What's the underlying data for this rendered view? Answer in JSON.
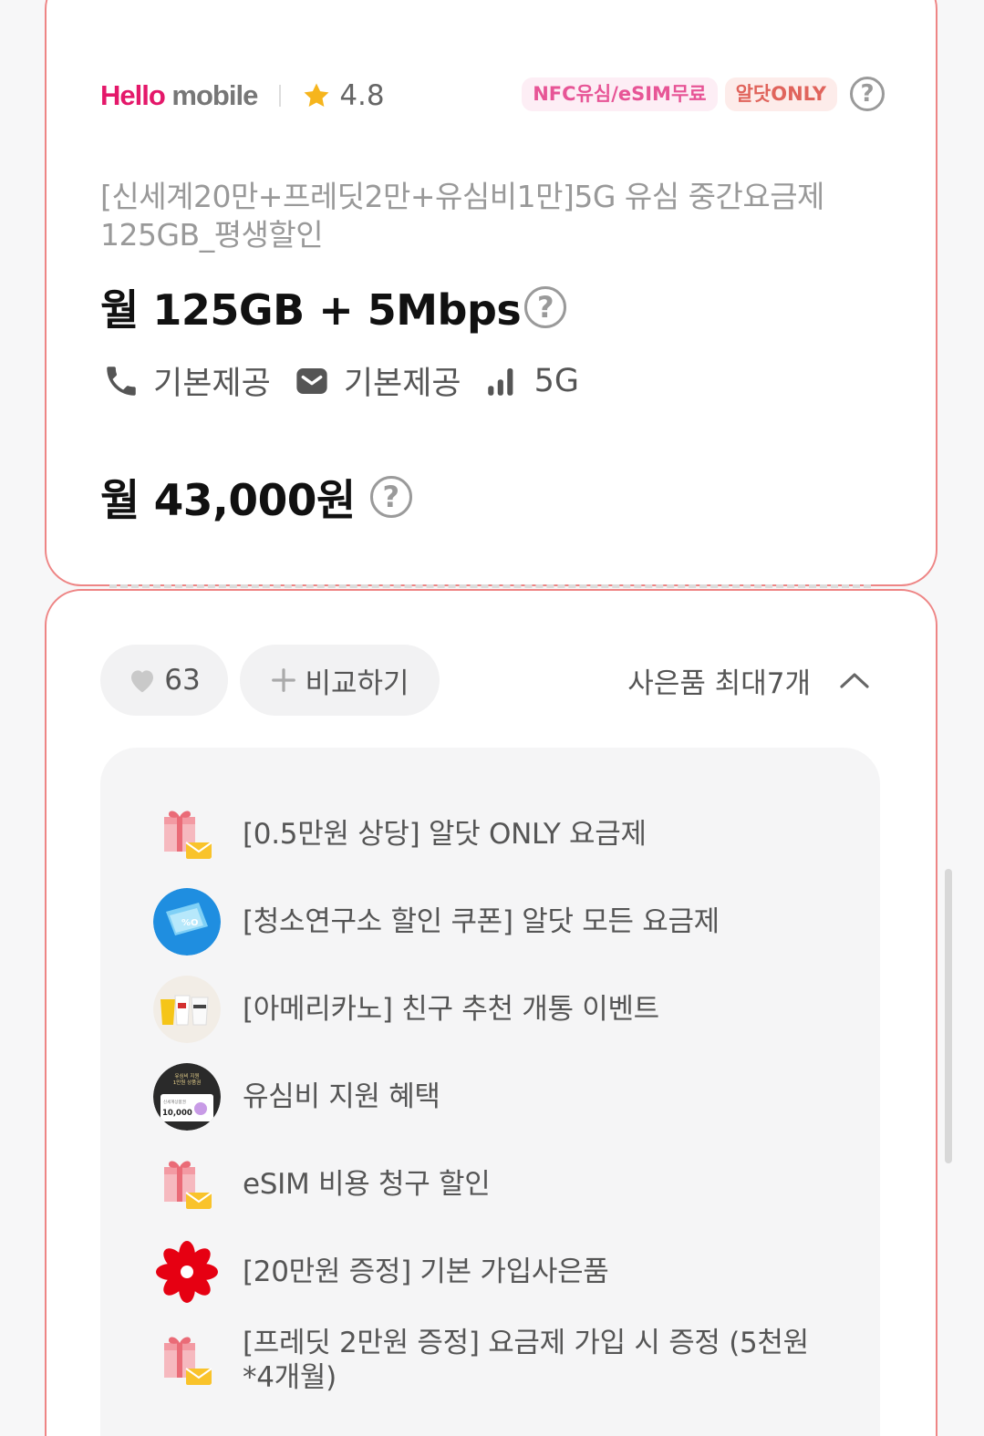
{
  "brand": {
    "logo_hello": "Hello",
    "logo_mobile": "mobile",
    "rating": "4.8"
  },
  "badges": {
    "nfc": "NFC유심/eSIM무료",
    "only": "알닷ONLY"
  },
  "plan": {
    "name": "[신세계20만+프레딧2만+유심비1만]5G 유심 중간요금제 125GB_평생할인",
    "data": "월 125GB + 5Mbps",
    "voice": "기본제공",
    "sms": "기본제공",
    "network": "5G",
    "price": "월 43,000원"
  },
  "actions": {
    "like_count": "63",
    "compare_label": "비교하기",
    "gifts_toggle_label": "사은품 최대7개"
  },
  "gifts": [
    {
      "icon": "gift-box-icon",
      "label": "[0.5만원 상당] 알닷 ONLY 요금제"
    },
    {
      "icon": "coupon-icon",
      "label": "[청소연구소 할인 쿠폰] 알닷 모든 요금제"
    },
    {
      "icon": "coffee-cups-icon",
      "label": "[아메리카노] 친구 추천 개통 이벤트"
    },
    {
      "icon": "usim-card-icon",
      "label": "유심비 지원 혜택",
      "thumb_text_top": "유심비 지원\n1만원 상품권",
      "thumb_amount": "10,000"
    },
    {
      "icon": "gift-box-icon",
      "label": "eSIM 비용 청구 할인"
    },
    {
      "icon": "shinsegae-logo-icon",
      "label": "[20만원 증정] 기본 가입사은품"
    },
    {
      "icon": "gift-box-icon",
      "label": "[프레딧 2만원 증정] 요금제 가입 시 증정 (5천원*4개월)"
    }
  ],
  "colors": {
    "card_border": "#ee8585",
    "brand_pink": "#e4186a",
    "badge_nfc_text": "#e75596",
    "badge_only_text": "#e0645c",
    "star": "#f6b51d"
  }
}
